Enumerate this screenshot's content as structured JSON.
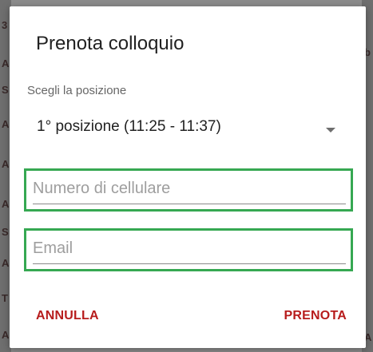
{
  "dialog": {
    "title": "Prenota colloquio",
    "position_label": "Scegli la posizione",
    "position_value": "1° posizione (11:25 - 11:37)",
    "phone_placeholder": "Numero di cellulare",
    "email_placeholder": "Email",
    "cancel_label": "ANNULLA",
    "confirm_label": "PRENOTA"
  },
  "colors": {
    "accent": "#b71c1c",
    "highlight_border": "#36a852"
  },
  "backdrop": {
    "left_glyphs": [
      "3",
      "A",
      "S",
      "A",
      "A",
      "A",
      "S",
      "A",
      "T",
      "A"
    ],
    "right_glyphs": [
      "b",
      "A"
    ]
  }
}
